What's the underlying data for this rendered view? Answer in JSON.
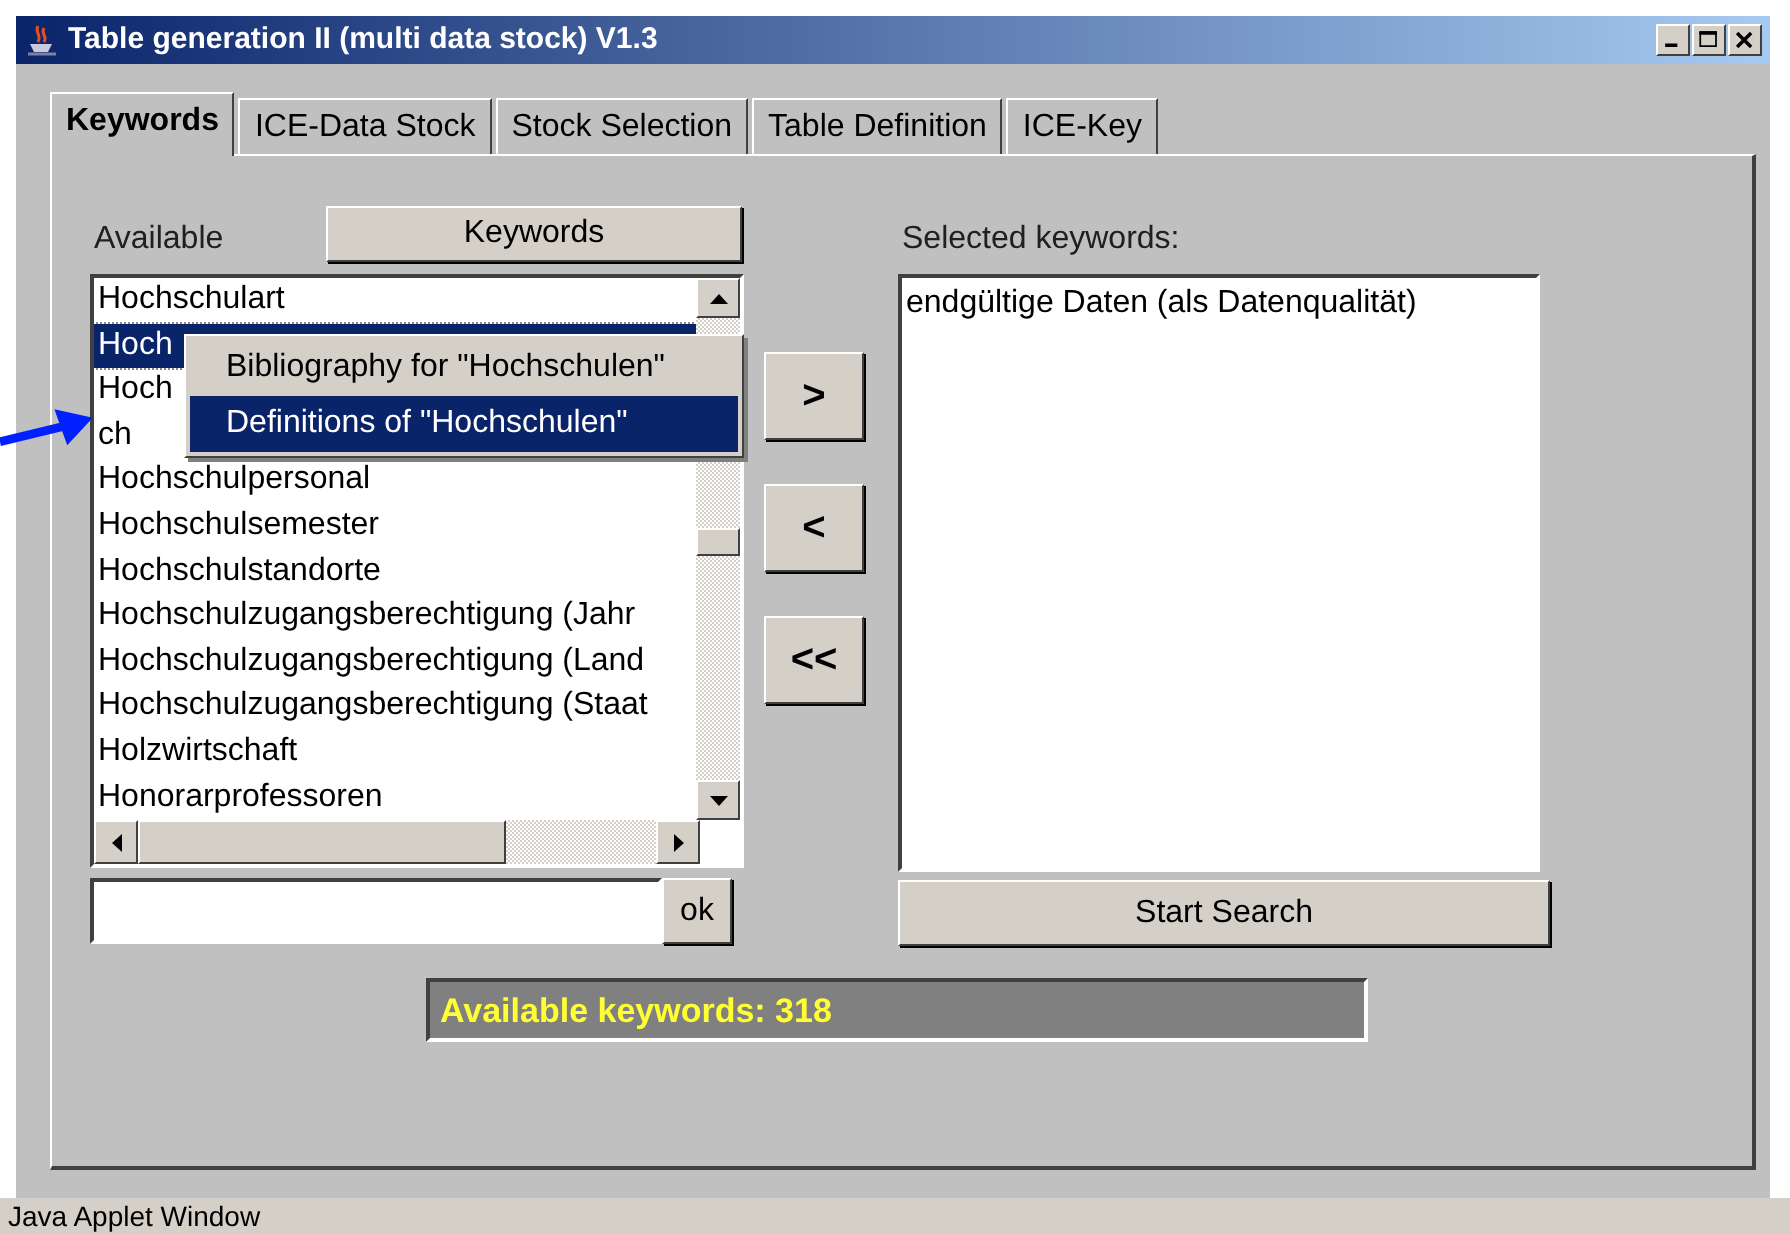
{
  "window": {
    "title": "Table generation II (multi data stock) V1.3"
  },
  "tabs": [
    {
      "label": "Keywords",
      "selected": true
    },
    {
      "label": "ICE-Data Stock",
      "selected": false
    },
    {
      "label": "Stock Selection",
      "selected": false
    },
    {
      "label": "Table Definition",
      "selected": false
    },
    {
      "label": "ICE-Key",
      "selected": false
    }
  ],
  "available": {
    "label": "Available",
    "keywords_button": "Keywords",
    "ok_button": "ok",
    "list": [
      {
        "text": "Hochschulart",
        "selected": false
      },
      {
        "text": "Hoch",
        "selected": true
      },
      {
        "text": "Hoch",
        "selected": false
      },
      {
        "text": "ch",
        "selected": false
      },
      {
        "text": "Hochschulpersonal",
        "selected": false
      },
      {
        "text": "Hochschulsemester",
        "selected": false
      },
      {
        "text": "Hochschulstandorte",
        "selected": false
      },
      {
        "text": "Hochschulzugangsberechtigung (Jahr",
        "selected": false
      },
      {
        "text": "Hochschulzugangsberechtigung (Land",
        "selected": false
      },
      {
        "text": "Hochschulzugangsberechtigung (Staat",
        "selected": false
      },
      {
        "text": "Holzwirtschaft",
        "selected": false
      },
      {
        "text": "Honorarprofessoren",
        "selected": false
      }
    ]
  },
  "context_menu": [
    {
      "label": "Bibliography for \"Hochschulen\"",
      "selected": false
    },
    {
      "label": "Definitions of \"Hochschulen\"",
      "selected": true
    }
  ],
  "move_buttons": [
    ">",
    "<",
    "<<"
  ],
  "selected": {
    "label": "Selected keywords:",
    "items": [
      "endgültige Daten (als Datenqualität)"
    ],
    "start_button": "Start Search"
  },
  "message": "Available keywords: 318",
  "status_bar": "Java Applet Window"
}
